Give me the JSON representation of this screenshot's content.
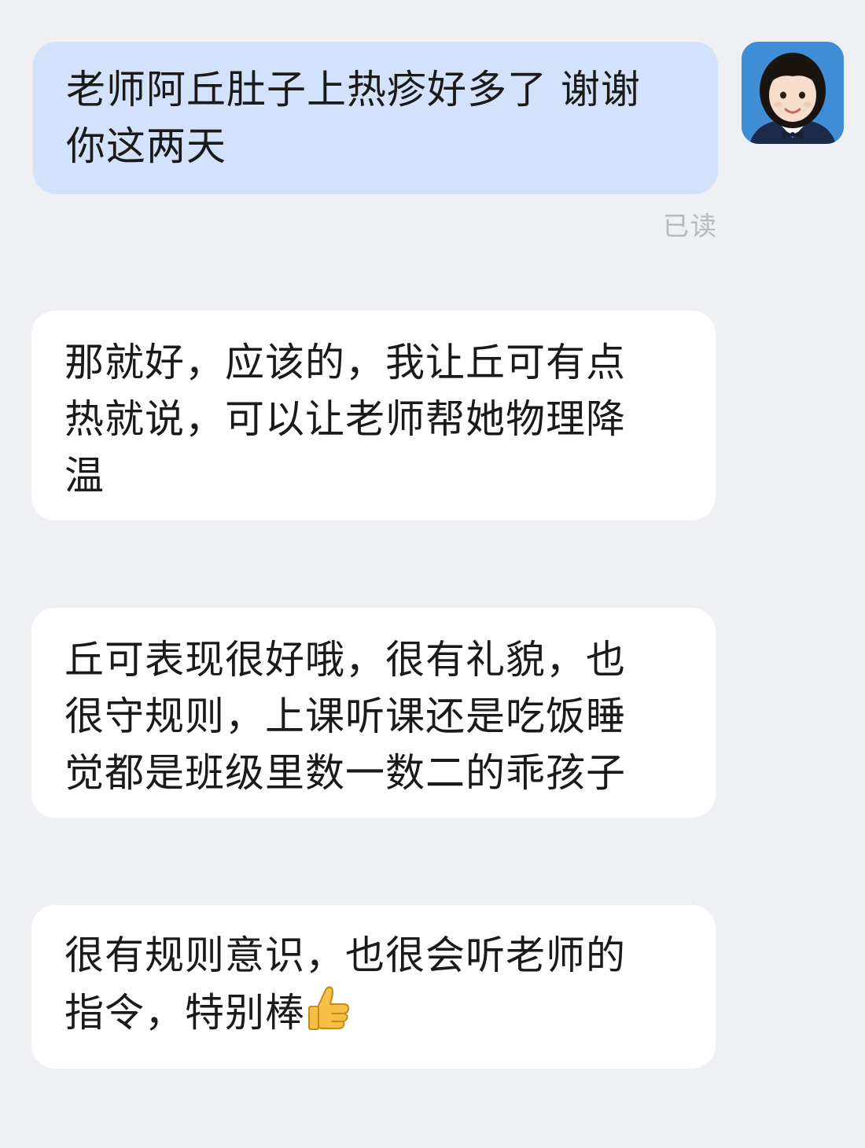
{
  "conversation": {
    "messages": [
      {
        "direction": "outgoing",
        "text": "老师阿丘肚子上热疹好多了 谢谢\n你这两天",
        "status": "已读"
      },
      {
        "direction": "incoming",
        "text": "那就好，应该的，我让丘可有点\n热就说，可以让老师帮她物理降\n温"
      },
      {
        "direction": "incoming",
        "text": "丘可表现很好哦，很有礼貌，也\n很守规则，上课听课还是吃饭睡\n觉都是班级里数一数二的乖孩子"
      },
      {
        "direction": "incoming",
        "text": "很有规则意识，也很会听老师的\n指令，特别棒",
        "emoji": "thumbs-up-icon"
      }
    ]
  },
  "colors": {
    "background": "#eef0f3",
    "outgoing_bubble": "#d3e2fb",
    "incoming_bubble": "#ffffff",
    "status_text": "#b6b9be",
    "avatar_background": "#3f8ed6"
  }
}
